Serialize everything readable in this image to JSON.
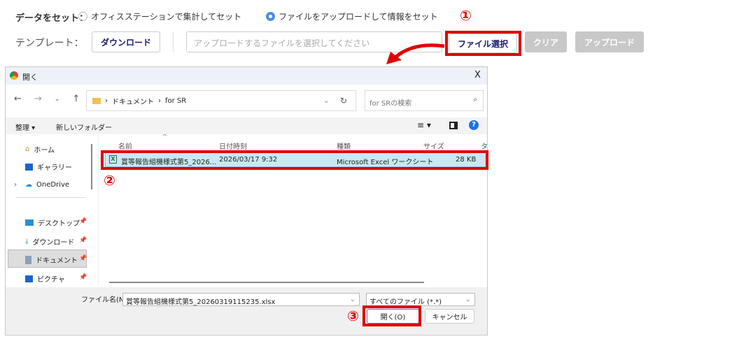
{
  "form": {
    "set_data_label": "データをセット：",
    "radio_options": [
      {
        "label": "オフィスステーションで集計してセット",
        "selected": false
      },
      {
        "label": "ファイルをアップロードして情報をセット",
        "selected": true
      }
    ],
    "template_label": "テンプレート：",
    "download_button": "ダウンロード",
    "file_input_placeholder": "アップロードするファイルを選択してください",
    "select_file_button": "ファイル選択",
    "clear_button": "クリア",
    "upload_button": "アップロード"
  },
  "annotations": {
    "step1": "①",
    "step2": "②",
    "step3": "③",
    "highlight_color": "#e00000"
  },
  "dialog": {
    "title": "開く",
    "close": "X",
    "breadcrumb": [
      "ドキュメント",
      "for SR"
    ],
    "search_placeholder": "for SRの検索",
    "organize": "整理 ▾",
    "new_folder": "新しいフォルダー",
    "help": "?",
    "sidebar": [
      "ホーム",
      "ギャラリー",
      "OneDrive",
      "デスクトップ",
      "ダウンロード",
      "ドキュメント",
      "ピクチャ"
    ],
    "columns": [
      "名前",
      "日付時刻",
      "種類",
      "サイズ",
      "タ"
    ],
    "files": [
      {
        "name": "賞等報告組機様式第5_2026...",
        "date": "2026/03/17 9:32",
        "type": "Microsoft Excel ワークシート",
        "size": "28 KB"
      }
    ],
    "filename_label": "ファイル名(N):",
    "filename_value": "賞等報告組機様式第5_20260319115235.xlsx",
    "filter_value": "すべてのファイル (*.*)",
    "open_button": "開く(O)",
    "cancel_button": "キャンセル"
  }
}
